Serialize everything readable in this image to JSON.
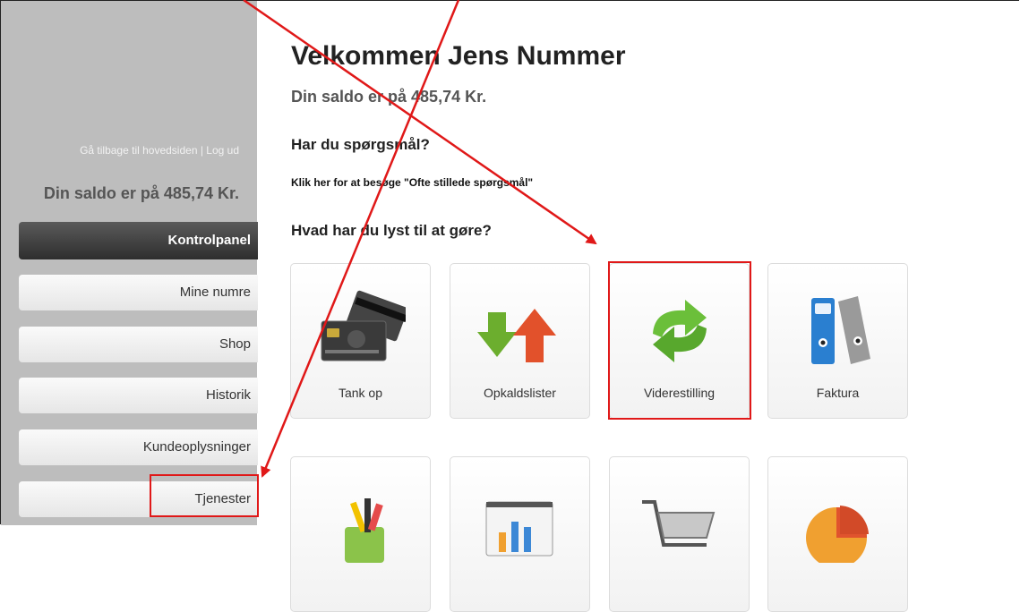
{
  "sidebar": {
    "links": "Gå tilbage til hovedsiden | Log ud",
    "saldo": "Din saldo er på 485,74 Kr.",
    "panel_title": "Kontrolpanel",
    "items": [
      {
        "label": "Mine numre"
      },
      {
        "label": "Shop"
      },
      {
        "label": "Historik"
      },
      {
        "label": "Kundeoplysninger"
      },
      {
        "label": "Tjenester"
      }
    ]
  },
  "main": {
    "welcome": "Velkommen Jens Nummer",
    "saldo": "Din saldo er på 485,74 Kr.",
    "question_heading": "Har du spørgsmål?",
    "faq_link": "Klik her for at besøge \"Ofte stillede spørgsmål\"",
    "actions_heading": "Hvad har du lyst til at gøre?",
    "tiles": [
      {
        "label": "Tank op",
        "icon": "credit-card-icon"
      },
      {
        "label": "Opkaldslister",
        "icon": "up-down-arrows-icon"
      },
      {
        "label": "Viderestilling",
        "icon": "forward-arrows-icon"
      },
      {
        "label": "Faktura",
        "icon": "binders-icon"
      },
      {
        "label": "",
        "icon": "pen-cup-icon"
      },
      {
        "label": "",
        "icon": "bar-chart-icon"
      },
      {
        "label": "",
        "icon": "shopping-cart-icon"
      },
      {
        "label": "",
        "icon": "pie-chart-icon"
      }
    ]
  },
  "annotation_color": "#e01818"
}
